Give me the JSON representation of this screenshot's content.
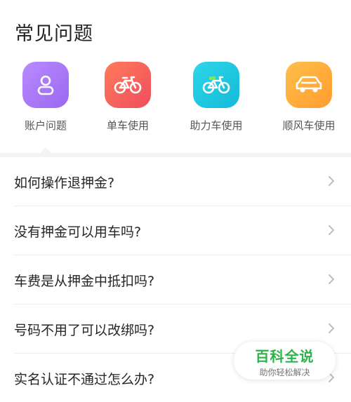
{
  "header": {
    "title": "常见问题"
  },
  "categories": [
    {
      "label": "账户问题",
      "icon": "user-icon",
      "color": "#a97af5"
    },
    {
      "label": "单车使用",
      "icon": "bicycle-icon",
      "color": "#f4625a"
    },
    {
      "label": "助力车使用",
      "icon": "ebike-icon",
      "color": "#1fc7e2"
    },
    {
      "label": "顺风车使用",
      "icon": "car-icon",
      "color": "#ffad3b"
    }
  ],
  "faq": [
    {
      "question": "如何操作退押金?"
    },
    {
      "question": "没有押金可以用车吗?"
    },
    {
      "question": "车费是从押金中抵扣吗?"
    },
    {
      "question": "号码不用了可以改绑吗?"
    },
    {
      "question": "实名认证不通过怎么办?"
    }
  ],
  "watermark": {
    "title": "百科全说",
    "subtitle": "助你轻松解决"
  }
}
